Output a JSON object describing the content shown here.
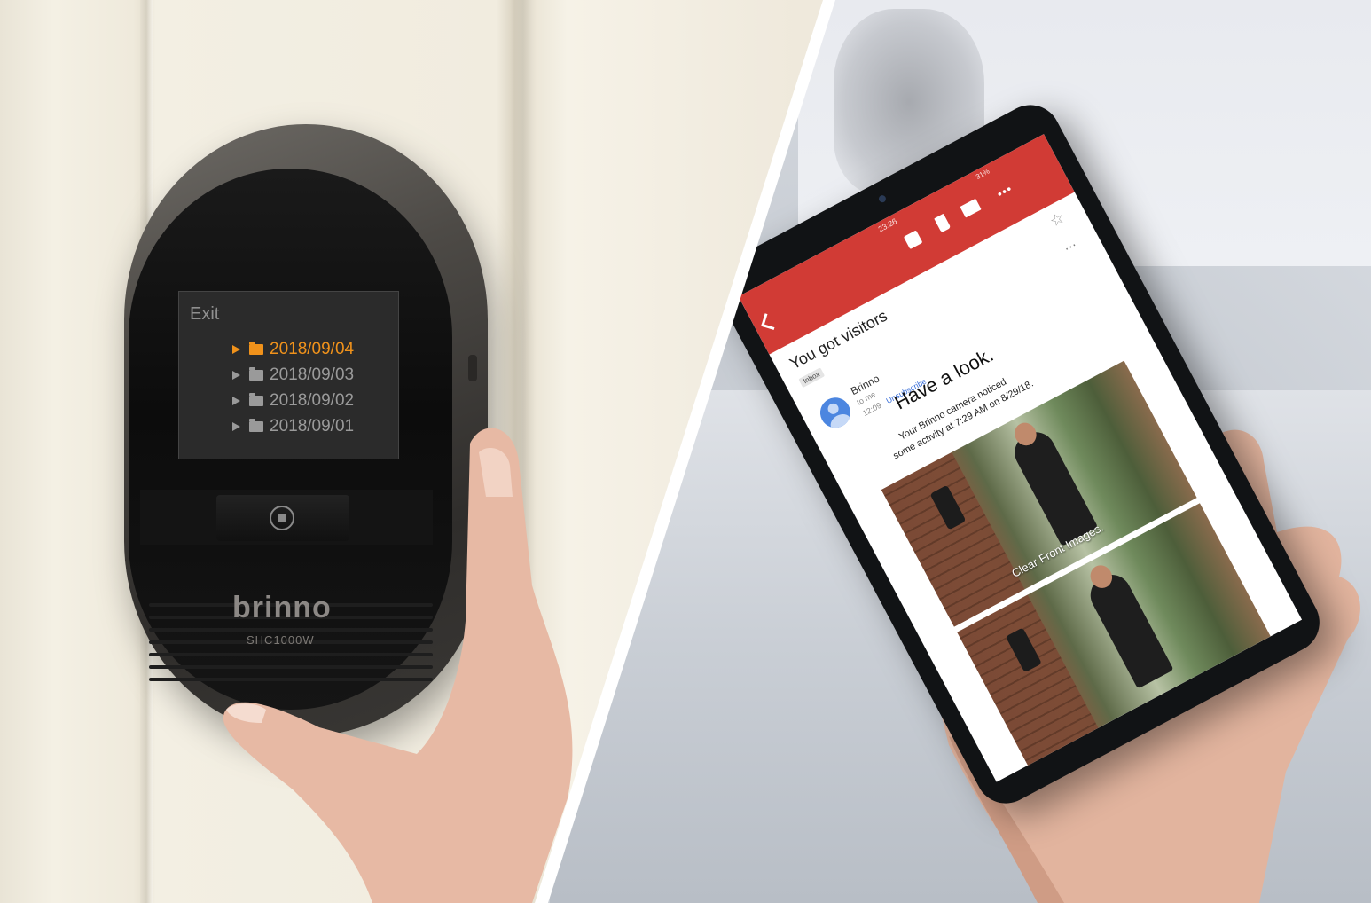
{
  "viewer": {
    "screen": {
      "exit_label": "Exit",
      "folders": [
        {
          "label": "2018/09/04",
          "selected": true
        },
        {
          "label": "2018/09/03",
          "selected": false
        },
        {
          "label": "2018/09/02",
          "selected": false
        },
        {
          "label": "2018/09/01",
          "selected": false
        }
      ]
    },
    "brand": "brinno",
    "model": "SHC1000W"
  },
  "phone": {
    "status_time": "23:26",
    "status_right": "31%",
    "email": {
      "subject": "You got visitors",
      "label": "Inbox",
      "sender": "Brinno",
      "sender_to": "to me",
      "time": "12:09",
      "tag": "Unsubscribe",
      "headline": "Have a look.",
      "body_line1": "Your Brinno camera noticed",
      "body_line2": "some activity at 7:29 AM on 8/29/18.",
      "image_caption": "Clear Front Images."
    }
  },
  "colors": {
    "accent_orange": "#f0921b",
    "gmail_red": "#d13b35",
    "screen_bg": "#2b2b2b"
  }
}
